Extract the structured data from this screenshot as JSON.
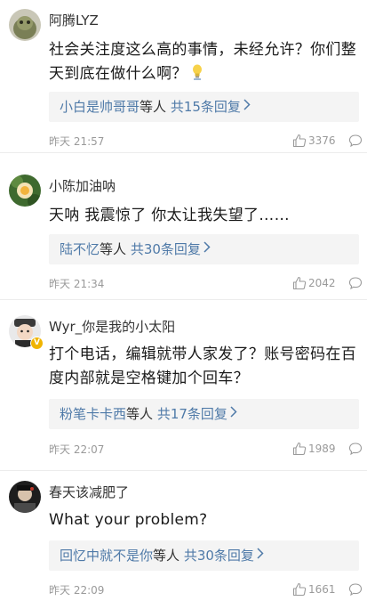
{
  "comments": [
    {
      "username": "阿腾LYZ",
      "text": "社会关注度这么高的事情，未经允许？你们整天到底在做什么啊？",
      "emoji_icon": "bulb-emoji-icon",
      "reply_names": "小白是帅哥哥",
      "reply_mid": "等人",
      "reply_count": "共15条回复",
      "time": "昨天 21:57",
      "likes": "3376"
    },
    {
      "username": "小陈加油呐",
      "text": "天呐 我震惊了 你太让我失望了……",
      "reply_names": "陆不忆",
      "reply_mid": "等人",
      "reply_count": "共30条回复",
      "time": "昨天 21:34",
      "likes": "2042"
    },
    {
      "username": "Wyr_你是我的小太阳",
      "badge": "V",
      "text": "打个电话，编辑就带人家发了？账号密码在百度内部就是空格键加个回车？",
      "reply_names": "粉笔卡卡西",
      "reply_mid": "等人",
      "reply_count": "共17条回复",
      "time": "昨天 22:07",
      "likes": "1989"
    },
    {
      "username": "春天该减肥了",
      "text": "What your problem?",
      "reply_names": "回忆中就不是你",
      "reply_mid": "等人",
      "reply_count": "共30条回复",
      "time": "昨天 22:09",
      "likes": "1661"
    }
  ],
  "colors": {
    "link": "#4f7aa8",
    "meta": "#9a9a9a",
    "reply_bg": "#f4f4f4",
    "badge": "#f0b400"
  }
}
